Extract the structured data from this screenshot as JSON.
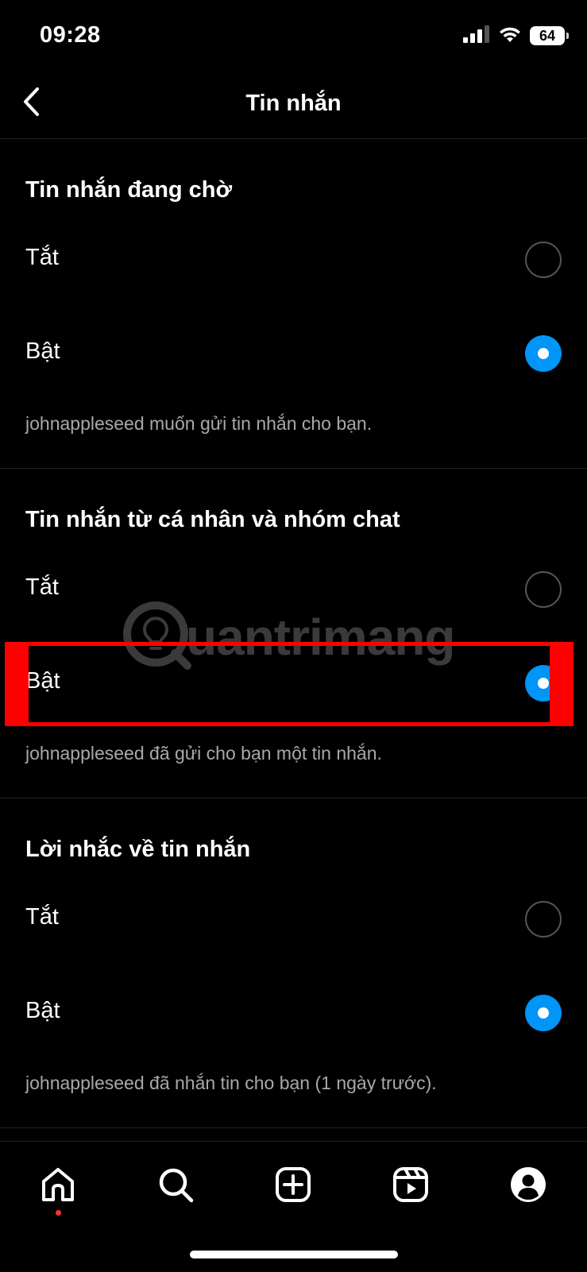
{
  "status_bar": {
    "time": "09:28",
    "battery": "64"
  },
  "header": {
    "title": "Tin nhắn"
  },
  "sections": [
    {
      "title": "Tin nhắn đang chờ",
      "options": [
        {
          "label": "Tắt",
          "selected": false
        },
        {
          "label": "Bật",
          "selected": true
        }
      ],
      "description": "johnappleseed muốn gửi tin nhắn cho bạn."
    },
    {
      "title": "Tin nhắn từ cá nhân và nhóm chat",
      "options": [
        {
          "label": "Tắt",
          "selected": false
        },
        {
          "label": "Bật",
          "selected": true
        }
      ],
      "description": "johnappleseed đã gửi cho bạn một tin nhắn."
    },
    {
      "title": "Lời nhắc về tin nhắn",
      "options": [
        {
          "label": "Tắt",
          "selected": false
        },
        {
          "label": "Bật",
          "selected": true
        }
      ],
      "description": "johnappleseed đã nhắn tin cho bạn (1 ngày trước)."
    }
  ],
  "watermark": {
    "text": "uantrimang"
  },
  "bottom_nav": {
    "items": [
      "home-icon",
      "search-icon",
      "create-post-icon",
      "reels-icon",
      "profile-icon"
    ],
    "active": "home-icon"
  },
  "colors": {
    "accent": "#0095f6",
    "highlight": "#ff0000",
    "notification_dot": "#ff3040"
  }
}
